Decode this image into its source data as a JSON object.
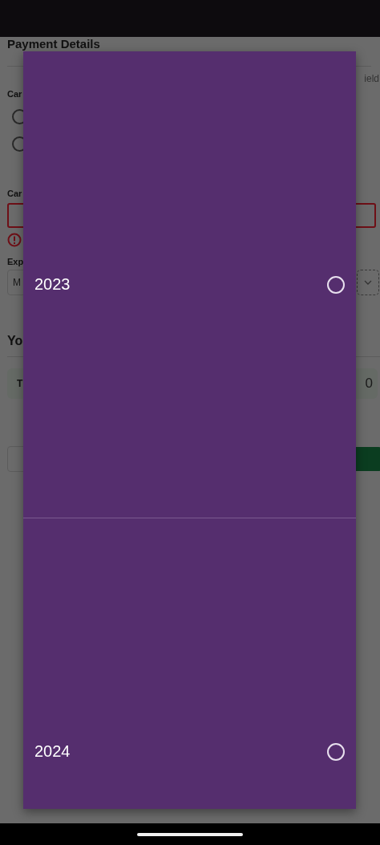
{
  "background_form": {
    "title": "Payment Details",
    "hint_fragment": "ield",
    "label_1": "Car",
    "radios": [
      {
        "selected": false
      },
      {
        "selected": false
      }
    ],
    "label_2": "Car",
    "card_field": {
      "error": true
    },
    "label_3": "Exp",
    "month_select": {
      "value": "M"
    },
    "section_title": "Yo",
    "total": {
      "label": "T",
      "value": "0"
    }
  },
  "year_picker": {
    "options": [
      {
        "label": "2023",
        "selected": false
      },
      {
        "label": "2024",
        "selected": false
      }
    ]
  }
}
